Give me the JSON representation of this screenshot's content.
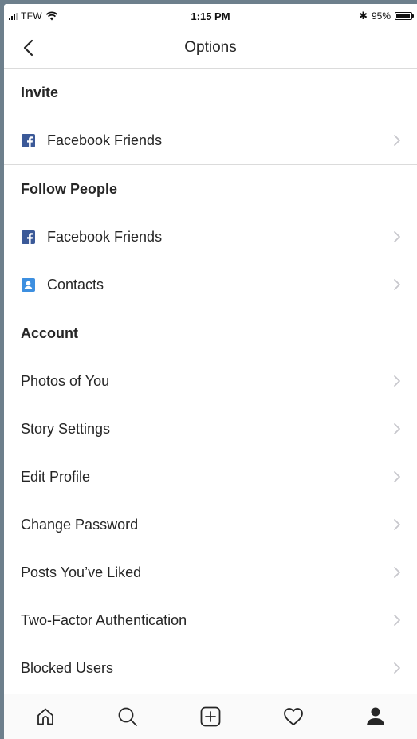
{
  "status_bar": {
    "carrier": "TFW",
    "time": "1:15 PM",
    "battery": "95%",
    "battery_level": 0.95
  },
  "header": {
    "title": "Options",
    "back_icon": "chevron-left-icon"
  },
  "sections": {
    "invite": {
      "title": "Invite",
      "items": [
        {
          "label": "Facebook Friends",
          "icon": "facebook-icon"
        }
      ]
    },
    "follow_people": {
      "title": "Follow People",
      "items": [
        {
          "label": "Facebook Friends",
          "icon": "facebook-icon"
        },
        {
          "label": "Contacts",
          "icon": "contacts-icon"
        }
      ]
    },
    "account": {
      "title": "Account",
      "items": [
        {
          "label": "Photos of You"
        },
        {
          "label": "Story Settings"
        },
        {
          "label": "Edit Profile"
        },
        {
          "label": "Change Password"
        },
        {
          "label": "Posts You’ve Liked"
        },
        {
          "label": "Two-Factor Authentication"
        },
        {
          "label": "Blocked Users"
        }
      ]
    }
  },
  "tab_bar": {
    "tabs": [
      "home-icon",
      "search-icon",
      "add-post-icon",
      "heart-icon",
      "profile-icon"
    ],
    "active": "profile-icon"
  },
  "colors": {
    "facebook": "#3b5998",
    "contacts": "#3d8fe0",
    "chevron": "#c7c7cc",
    "text": "#262626",
    "divider": "#dbdbdb"
  }
}
